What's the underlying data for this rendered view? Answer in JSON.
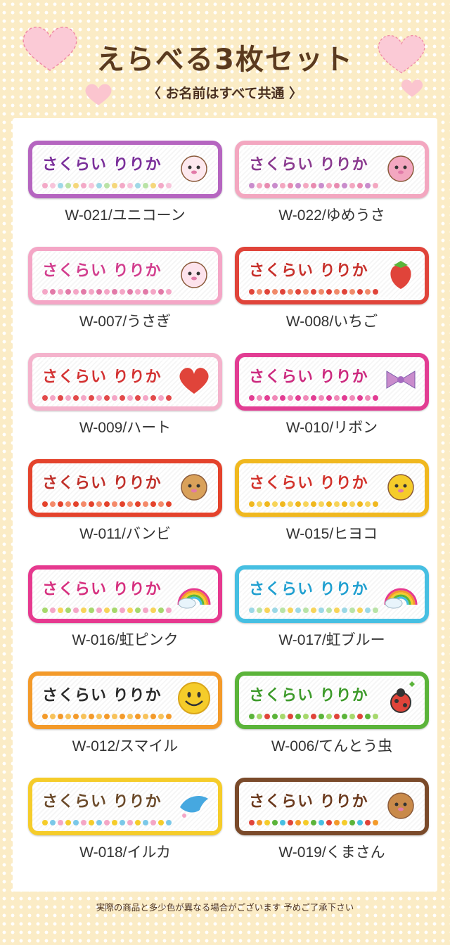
{
  "header": {
    "title": "えらべる3枚セット",
    "subtitle": "〈 お名前はすべて共通 〉"
  },
  "patch_name": "さくらい りりか",
  "items": [
    {
      "code": "W-021/ユニコーン",
      "border": "#b565c0",
      "text": "#7a2f9a",
      "dots": [
        "#f3a9c7",
        "#f7c4da",
        "#9fd8e6",
        "#b9e3a6",
        "#f5d77a"
      ],
      "icon": "unicorn-icon"
    },
    {
      "code": "W-022/ゆめうさ",
      "border": "#f3a7c0",
      "text": "#8a3a8f",
      "dots": [
        "#c98ccc",
        "#f3a7c0",
        "#e88bb0"
      ],
      "icon": "bunny-icon"
    },
    {
      "code": "W-007/うさぎ",
      "border": "#f4a6c6",
      "text": "#d23e8e",
      "dots": [
        "#f4a6c6",
        "#e27aa8"
      ],
      "icon": "rabbit-icon"
    },
    {
      "code": "W-008/いちご",
      "border": "#e0443a",
      "text": "#c7302b",
      "dots": [
        "#e0443a",
        "#f08a6a"
      ],
      "icon": "strawberry-icon"
    },
    {
      "code": "W-009/ハート",
      "border": "#f4b3cc",
      "text": "#d33232",
      "dots": [
        "#e24a4a",
        "#f4a6c6"
      ],
      "icon": "heart-icon"
    },
    {
      "code": "W-010/リボン",
      "border": "#e23d93",
      "text": "#cc2a7f",
      "dots": [
        "#e23d93",
        "#f08ab8"
      ],
      "icon": "ribbon-icon"
    },
    {
      "code": "W-011/バンビ",
      "border": "#e4432c",
      "text": "#c0302a",
      "dots": [
        "#e4432c",
        "#f48a6a"
      ],
      "icon": "deer-icon"
    },
    {
      "code": "W-015/ヒヨコ",
      "border": "#f0b81f",
      "text": "#d2312a",
      "dots": [
        "#f0b81f",
        "#f7d45a"
      ],
      "icon": "chick-icon"
    },
    {
      "code": "W-016/虹ピンク",
      "border": "#e6398f",
      "text": "#d6307f",
      "dots": [
        "#a6d86c",
        "#f4a6c6",
        "#f7d45a"
      ],
      "icon": "rainbow-icon"
    },
    {
      "code": "W-017/虹ブルー",
      "border": "#46bfe2",
      "text": "#1f9fd0",
      "dots": [
        "#9bd8e6",
        "#b9e3a6",
        "#f7d45a"
      ],
      "icon": "rainbow-icon"
    },
    {
      "code": "W-012/スマイル",
      "border": "#f39a2a",
      "text": "#2a2a2a",
      "dots": [
        "#f39a2a",
        "#f7c25a"
      ],
      "icon": "smile-icon"
    },
    {
      "code": "W-006/てんとう虫",
      "border": "#5bb43a",
      "text": "#3d9a2a",
      "dots": [
        "#5bb43a",
        "#a6d86c",
        "#e0443a"
      ],
      "icon": "ladybug-icon"
    },
    {
      "code": "W-018/イルカ",
      "border": "#f5cc2a",
      "text": "#6b4a2a",
      "dots": [
        "#f5cc2a",
        "#7ac8e8",
        "#f4a6c6"
      ],
      "icon": "dolphin-icon"
    },
    {
      "code": "W-019/くまさん",
      "border": "#7a4a2a",
      "text": "#6b3a1e",
      "dots": [
        "#e0443a",
        "#f39a2a",
        "#f5cc2a",
        "#5bb43a",
        "#46bfe2"
      ],
      "icon": "bear-icon"
    }
  ],
  "footer": "実際の商品と多少色が異なる場合がございます 予めご了承下さい"
}
